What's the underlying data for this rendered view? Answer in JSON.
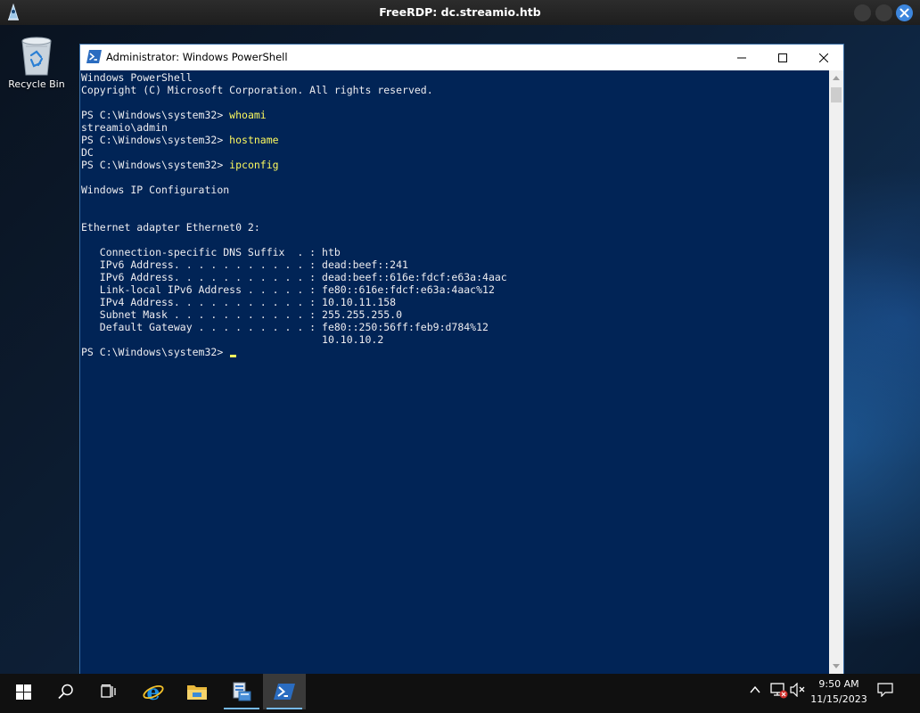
{
  "rdp": {
    "title": "FreeRDP: dc.streamio.htb"
  },
  "desktop": {
    "recycle_bin_label": "Recycle Bin"
  },
  "powershell": {
    "title": "Administrator: Windows PowerShell",
    "lines": [
      {
        "text": "Windows PowerShell"
      },
      {
        "text": "Copyright (C) Microsoft Corporation. All rights reserved."
      },
      {
        "text": ""
      },
      {
        "prompt": "PS C:\\Windows\\system32> ",
        "command": "whoami"
      },
      {
        "text": "streamio\\admin"
      },
      {
        "prompt": "PS C:\\Windows\\system32> ",
        "command": "hostname"
      },
      {
        "text": "DC"
      },
      {
        "prompt": "PS C:\\Windows\\system32> ",
        "command": "ipconfig"
      },
      {
        "text": ""
      },
      {
        "text": "Windows IP Configuration"
      },
      {
        "text": ""
      },
      {
        "text": ""
      },
      {
        "text": "Ethernet adapter Ethernet0 2:"
      },
      {
        "text": ""
      },
      {
        "text": "   Connection-specific DNS Suffix  . : htb"
      },
      {
        "text": "   IPv6 Address. . . . . . . . . . . : dead:beef::241"
      },
      {
        "text": "   IPv6 Address. . . . . . . . . . . : dead:beef::616e:fdcf:e63a:4aac"
      },
      {
        "text": "   Link-local IPv6 Address . . . . . : fe80::616e:fdcf:e63a:4aac%12"
      },
      {
        "text": "   IPv4 Address. . . . . . . . . . . : 10.10.11.158"
      },
      {
        "text": "   Subnet Mask . . . . . . . . . . . : 255.255.255.0"
      },
      {
        "text": "   Default Gateway . . . . . . . . . : fe80::250:56ff:feb9:d784%12"
      },
      {
        "text": "                                       10.10.10.2"
      },
      {
        "prompt": "PS C:\\Windows\\system32> ",
        "command": "",
        "cursor": true
      }
    ]
  },
  "taskbar": {
    "pinned": [
      "start-icon",
      "search-icon",
      "task-view-icon",
      "internet-explorer-icon",
      "file-explorer-icon",
      "server-manager-icon",
      "powershell-icon"
    ],
    "time": "9:50 AM",
    "date": "11/15/2023"
  },
  "colors": {
    "ps_background": "#012456",
    "ps_text": "#eeedf0",
    "ps_command": "#fdf95e",
    "taskbar": "#101010",
    "accent": "#3d86dd"
  }
}
